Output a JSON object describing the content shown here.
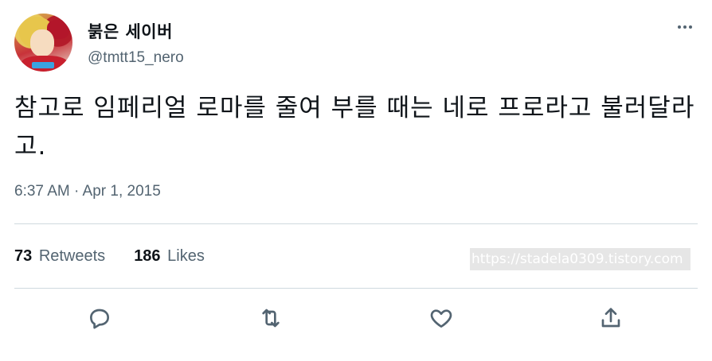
{
  "user": {
    "display_name": "붉은 세이버",
    "handle": "@tmtt15_nero"
  },
  "tweet": {
    "text": "참고로 임페리얼 로마를 줄여 부를 때는 네로 프로라고 불러달라고.",
    "timestamp": "6:37 AM · Apr 1, 2015"
  },
  "stats": {
    "retweets_count": "73",
    "retweets_label": "Retweets",
    "likes_count": "186",
    "likes_label": "Likes"
  },
  "watermark": "https://stadela0309.tistory.com",
  "icons": {
    "more": "more-icon",
    "reply": "reply-icon",
    "retweet": "retweet-icon",
    "like": "like-icon",
    "share": "share-icon"
  }
}
